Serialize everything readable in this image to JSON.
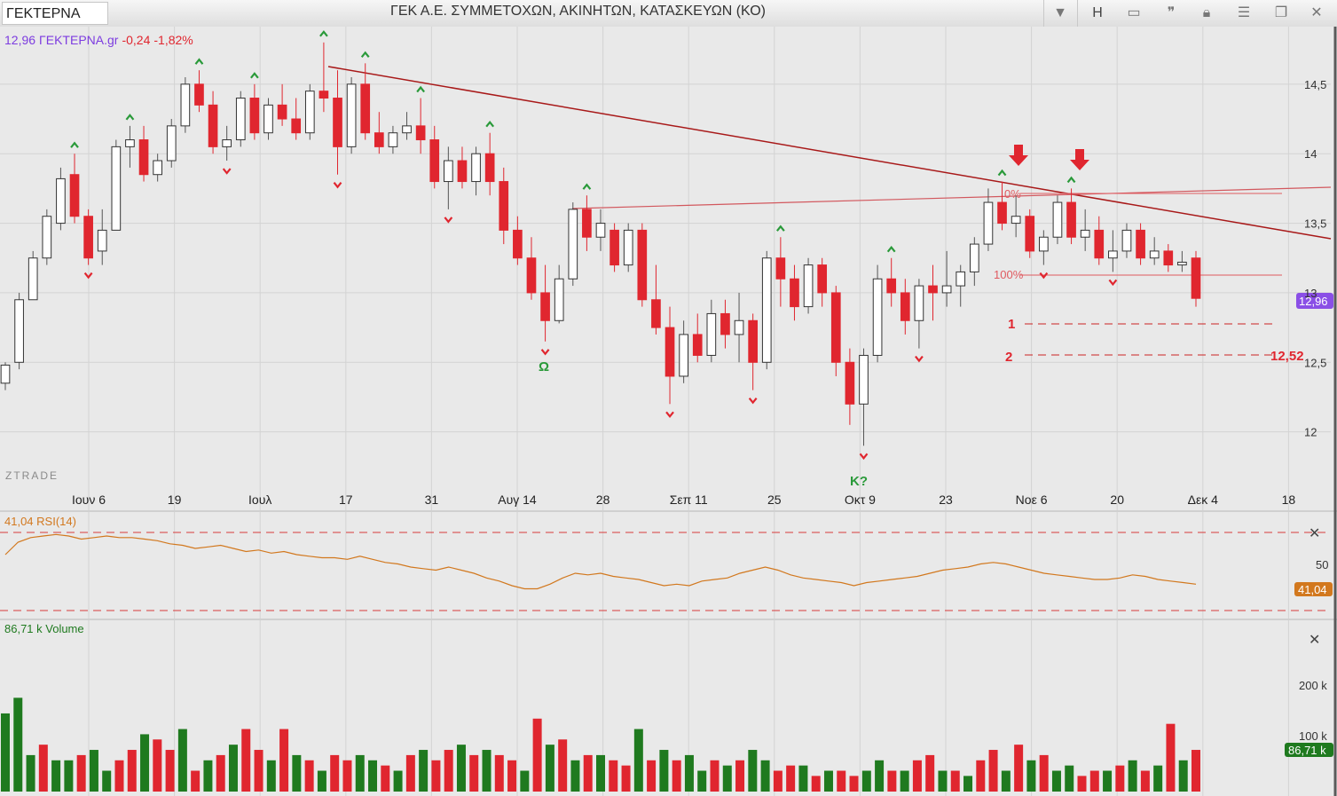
{
  "toolbar": {
    "symbol": "ΓΕΚΤΕΡΝΑ",
    "title": "ΓΕΚ  Α.Ε. ΣΥΜΜΕΤΟΧΩΝ, ΑΚΙΝΗΤΩΝ, ΚΑΤΑΣΚΕΥΩΝ (ΚΟ)",
    "h_label": "H",
    "icons": [
      "chevron-down-icon",
      "window-icon",
      "quote-icon",
      "lock-icon",
      "menu-icon",
      "restore-icon",
      "close-icon"
    ]
  },
  "colors": {
    "up": "#1f7a1f",
    "down": "#e0262f",
    "doji": "#555555",
    "trendline": "#a81919",
    "rsi": "#d2781e",
    "accent": "#7d3ce0"
  },
  "chart_data": [
    {
      "type": "candlestick",
      "header": {
        "last": "12,96",
        "symbol": "ΓΕΚΤΕΡΝΑ.gr",
        "change": "-0,24",
        "change_pct": "-1,82%"
      },
      "watermark": "ZTRADE",
      "x_ticks": [
        "Ιουν 6",
        "19",
        "Ιουλ",
        "17",
        "31",
        "Αυγ 14",
        "28",
        "Σεπ 11",
        "25",
        "Οκτ 9",
        "23",
        "Νοε 6",
        "20",
        "Δεκ 4",
        "18"
      ],
      "y_ticks": [
        "14,5",
        "14",
        "13,5",
        "13",
        "12,5",
        "12"
      ],
      "ylim": [
        11.5,
        14.85
      ],
      "price_tag": "12,96",
      "level_tag": "12,52",
      "annotations": {
        "omega": "Ω",
        "k": "Κ?",
        "fib_0": "0%",
        "fib_100": "100%",
        "n1": "1",
        "n2": "2"
      },
      "candles": [
        {
          "o": 12.35,
          "h": 12.5,
          "l": 12.3,
          "c": 12.48
        },
        {
          "o": 12.5,
          "h": 13.0,
          "l": 12.45,
          "c": 12.95
        },
        {
          "o": 12.95,
          "h": 13.3,
          "l": 12.95,
          "c": 13.25
        },
        {
          "o": 13.25,
          "h": 13.6,
          "l": 13.2,
          "c": 13.55
        },
        {
          "o": 13.5,
          "h": 13.9,
          "l": 13.45,
          "c": 13.82
        },
        {
          "o": 13.85,
          "h": 14.0,
          "l": 13.5,
          "c": 13.55
        },
        {
          "o": 13.55,
          "h": 13.6,
          "l": 13.2,
          "c": 13.25
        },
        {
          "o": 13.3,
          "h": 13.6,
          "l": 13.2,
          "c": 13.45
        },
        {
          "o": 13.45,
          "h": 14.1,
          "l": 13.45,
          "c": 14.05
        },
        {
          "o": 14.05,
          "h": 14.2,
          "l": 13.9,
          "c": 14.1
        },
        {
          "o": 14.1,
          "h": 14.2,
          "l": 13.8,
          "c": 13.85
        },
        {
          "o": 13.85,
          "h": 14.0,
          "l": 13.8,
          "c": 13.95
        },
        {
          "o": 13.95,
          "h": 14.25,
          "l": 13.9,
          "c": 14.2
        },
        {
          "o": 14.2,
          "h": 14.55,
          "l": 14.15,
          "c": 14.5
        },
        {
          "o": 14.5,
          "h": 14.6,
          "l": 14.3,
          "c": 14.35
        },
        {
          "o": 14.35,
          "h": 14.45,
          "l": 14.0,
          "c": 14.05
        },
        {
          "o": 14.05,
          "h": 14.2,
          "l": 13.95,
          "c": 14.1
        },
        {
          "o": 14.1,
          "h": 14.45,
          "l": 14.05,
          "c": 14.4
        },
        {
          "o": 14.4,
          "h": 14.5,
          "l": 14.1,
          "c": 14.15
        },
        {
          "o": 14.15,
          "h": 14.4,
          "l": 14.1,
          "c": 14.35
        },
        {
          "o": 14.35,
          "h": 14.5,
          "l": 14.2,
          "c": 14.25
        },
        {
          "o": 14.25,
          "h": 14.4,
          "l": 14.1,
          "c": 14.15
        },
        {
          "o": 14.15,
          "h": 14.5,
          "l": 14.1,
          "c": 14.45
        },
        {
          "o": 14.45,
          "h": 14.8,
          "l": 14.3,
          "c": 14.4
        },
        {
          "o": 14.4,
          "h": 14.6,
          "l": 13.85,
          "c": 14.05
        },
        {
          "o": 14.05,
          "h": 14.55,
          "l": 14.0,
          "c": 14.5
        },
        {
          "o": 14.5,
          "h": 14.65,
          "l": 14.1,
          "c": 14.15
        },
        {
          "o": 14.15,
          "h": 14.3,
          "l": 14.0,
          "c": 14.05
        },
        {
          "o": 14.05,
          "h": 14.2,
          "l": 14.0,
          "c": 14.15
        },
        {
          "o": 14.15,
          "h": 14.3,
          "l": 14.1,
          "c": 14.2
        },
        {
          "o": 14.2,
          "h": 14.4,
          "l": 14.0,
          "c": 14.1
        },
        {
          "o": 14.1,
          "h": 14.2,
          "l": 13.75,
          "c": 13.8
        },
        {
          "o": 13.8,
          "h": 14.05,
          "l": 13.6,
          "c": 13.95
        },
        {
          "o": 13.95,
          "h": 14.05,
          "l": 13.75,
          "c": 13.8
        },
        {
          "o": 13.8,
          "h": 14.05,
          "l": 13.7,
          "c": 14.0
        },
        {
          "o": 14.0,
          "h": 14.15,
          "l": 13.7,
          "c": 13.8
        },
        {
          "o": 13.8,
          "h": 13.9,
          "l": 13.35,
          "c": 13.45
        },
        {
          "o": 13.45,
          "h": 13.55,
          "l": 13.2,
          "c": 13.25
        },
        {
          "o": 13.25,
          "h": 13.4,
          "l": 12.95,
          "c": 13.0
        },
        {
          "o": 13.0,
          "h": 13.2,
          "l": 12.65,
          "c": 12.8
        },
        {
          "o": 12.8,
          "h": 13.2,
          "l": 12.78,
          "c": 13.1
        },
        {
          "o": 13.1,
          "h": 13.65,
          "l": 13.05,
          "c": 13.6
        },
        {
          "o": 13.6,
          "h": 13.7,
          "l": 13.3,
          "c": 13.4
        },
        {
          "o": 13.4,
          "h": 13.6,
          "l": 13.3,
          "c": 13.5
        },
        {
          "o": 13.45,
          "h": 13.5,
          "l": 13.15,
          "c": 13.2
        },
        {
          "o": 13.2,
          "h": 13.5,
          "l": 13.15,
          "c": 13.45
        },
        {
          "o": 13.45,
          "h": 13.5,
          "l": 12.9,
          "c": 12.95
        },
        {
          "o": 12.95,
          "h": 13.2,
          "l": 12.7,
          "c": 12.75
        },
        {
          "o": 12.75,
          "h": 12.9,
          "l": 12.2,
          "c": 12.4
        },
        {
          "o": 12.4,
          "h": 12.8,
          "l": 12.35,
          "c": 12.7
        },
        {
          "o": 12.7,
          "h": 12.85,
          "l": 12.5,
          "c": 12.55
        },
        {
          "o": 12.55,
          "h": 12.95,
          "l": 12.5,
          "c": 12.85
        },
        {
          "o": 12.85,
          "h": 12.95,
          "l": 12.6,
          "c": 12.7
        },
        {
          "o": 12.7,
          "h": 13.0,
          "l": 12.5,
          "c": 12.8
        },
        {
          "o": 12.8,
          "h": 12.85,
          "l": 12.3,
          "c": 12.5
        },
        {
          "o": 12.5,
          "h": 13.3,
          "l": 12.45,
          "c": 13.25
        },
        {
          "o": 13.25,
          "h": 13.4,
          "l": 12.9,
          "c": 13.1
        },
        {
          "o": 13.1,
          "h": 13.2,
          "l": 12.8,
          "c": 12.9
        },
        {
          "o": 12.9,
          "h": 13.25,
          "l": 12.85,
          "c": 13.2
        },
        {
          "o": 13.2,
          "h": 13.25,
          "l": 12.9,
          "c": 13.0
        },
        {
          "o": 13.0,
          "h": 13.05,
          "l": 12.4,
          "c": 12.5
        },
        {
          "o": 12.5,
          "h": 12.6,
          "l": 12.05,
          "c": 12.2
        },
        {
          "o": 12.2,
          "h": 12.6,
          "l": 11.9,
          "c": 12.55
        },
        {
          "o": 12.55,
          "h": 13.2,
          "l": 12.5,
          "c": 13.1
        },
        {
          "o": 13.1,
          "h": 13.25,
          "l": 12.9,
          "c": 13.0
        },
        {
          "o": 13.0,
          "h": 13.1,
          "l": 12.7,
          "c": 12.8
        },
        {
          "o": 12.8,
          "h": 13.1,
          "l": 12.6,
          "c": 13.05
        },
        {
          "o": 13.05,
          "h": 13.2,
          "l": 12.8,
          "c": 13.0
        },
        {
          "o": 13.0,
          "h": 13.3,
          "l": 12.9,
          "c": 13.05
        },
        {
          "o": 13.05,
          "h": 13.2,
          "l": 12.9,
          "c": 13.15
        },
        {
          "o": 13.15,
          "h": 13.4,
          "l": 13.05,
          "c": 13.35
        },
        {
          "o": 13.35,
          "h": 13.75,
          "l": 13.3,
          "c": 13.65
        },
        {
          "o": 13.65,
          "h": 13.8,
          "l": 13.45,
          "c": 13.5
        },
        {
          "o": 13.5,
          "h": 13.7,
          "l": 13.4,
          "c": 13.55
        },
        {
          "o": 13.55,
          "h": 13.6,
          "l": 13.25,
          "c": 13.3
        },
        {
          "o": 13.3,
          "h": 13.45,
          "l": 13.2,
          "c": 13.4
        },
        {
          "o": 13.4,
          "h": 13.7,
          "l": 13.35,
          "c": 13.65
        },
        {
          "o": 13.65,
          "h": 13.75,
          "l": 13.35,
          "c": 13.4
        },
        {
          "o": 13.4,
          "h": 13.6,
          "l": 13.3,
          "c": 13.45
        },
        {
          "o": 13.45,
          "h": 13.55,
          "l": 13.2,
          "c": 13.25
        },
        {
          "o": 13.25,
          "h": 13.45,
          "l": 13.15,
          "c": 13.3
        },
        {
          "o": 13.3,
          "h": 13.5,
          "l": 13.25,
          "c": 13.45
        },
        {
          "o": 13.45,
          "h": 13.5,
          "l": 13.2,
          "c": 13.25
        },
        {
          "o": 13.25,
          "h": 13.4,
          "l": 13.2,
          "c": 13.3
        },
        {
          "o": 13.3,
          "h": 13.35,
          "l": 13.15,
          "c": 13.2
        },
        {
          "o": 13.2,
          "h": 13.3,
          "l": 13.15,
          "c": 13.22
        },
        {
          "o": 13.25,
          "h": 13.3,
          "l": 12.9,
          "c": 12.96
        }
      ]
    },
    {
      "type": "line",
      "label": "41,04 RSI(14)",
      "value_tag": "41,04",
      "y_ticks": [
        "50"
      ],
      "ylim": [
        20,
        80
      ],
      "bands": [
        70,
        30
      ],
      "values": [
        60,
        68,
        71,
        72,
        73,
        72,
        70,
        71,
        72,
        71,
        71,
        70,
        69,
        67,
        66,
        64,
        65,
        66,
        64,
        62,
        63,
        61,
        62,
        60,
        59,
        58,
        58,
        57,
        59,
        57,
        55,
        54,
        52,
        51,
        50,
        52,
        50,
        48,
        45,
        43,
        40,
        38,
        38,
        41,
        45,
        48,
        47,
        48,
        46,
        45,
        44,
        42,
        40,
        41,
        40,
        43,
        44,
        45,
        48,
        50,
        52,
        50,
        47,
        45,
        44,
        43,
        42,
        40,
        42,
        43,
        44,
        45,
        46,
        48,
        50,
        51,
        52,
        54,
        55,
        54,
        52,
        50,
        48,
        47,
        46,
        45,
        44,
        44,
        45,
        47,
        46,
        44,
        43,
        42,
        41
      ]
    },
    {
      "type": "bar",
      "label": "86,71 k Volume",
      "value_tag": "86,71 k",
      "y_ticks": [
        "200 k",
        "100 k"
      ],
      "ylim": [
        0,
        310
      ],
      "values": [
        150,
        180,
        70,
        90,
        60,
        60,
        70,
        80,
        40,
        60,
        80,
        110,
        100,
        80,
        120,
        40,
        60,
        70,
        90,
        120,
        80,
        60,
        120,
        70,
        60,
        40,
        70,
        60,
        70,
        60,
        50,
        40,
        70,
        80,
        60,
        80,
        90,
        70,
        80,
        70,
        60,
        40,
        140,
        90,
        100,
        60,
        70,
        70,
        60,
        50,
        120,
        60,
        80,
        60,
        70,
        40,
        60,
        50,
        60,
        80,
        60,
        40,
        50,
        50,
        30,
        40,
        40,
        30,
        40,
        60,
        40,
        40,
        60,
        70,
        40,
        40,
        30,
        60,
        80,
        40,
        90,
        60,
        70,
        40,
        50,
        30,
        40,
        40,
        50,
        60,
        40,
        50,
        130,
        60,
        80
      ],
      "up": [
        true,
        true,
        true,
        false,
        true,
        true,
        false,
        true,
        true,
        false,
        false,
        true,
        false,
        false,
        true,
        false,
        true,
        false,
        true,
        false,
        false,
        true,
        false,
        true,
        false,
        true,
        false,
        false,
        true,
        true,
        false,
        true,
        false,
        true,
        false,
        false,
        true,
        false,
        true,
        false,
        false,
        true,
        false,
        true,
        false,
        true,
        false,
        true,
        false,
        false,
        true,
        false,
        true,
        false,
        true,
        true,
        false,
        true,
        false,
        true,
        true,
        false,
        false,
        true,
        false,
        true,
        false,
        false,
        true,
        true,
        false,
        true,
        false,
        false,
        true,
        false,
        true,
        false,
        false,
        true,
        false,
        true,
        false,
        true,
        true,
        false,
        false,
        true,
        false,
        true,
        false,
        true,
        false,
        true,
        false
      ]
    }
  ]
}
